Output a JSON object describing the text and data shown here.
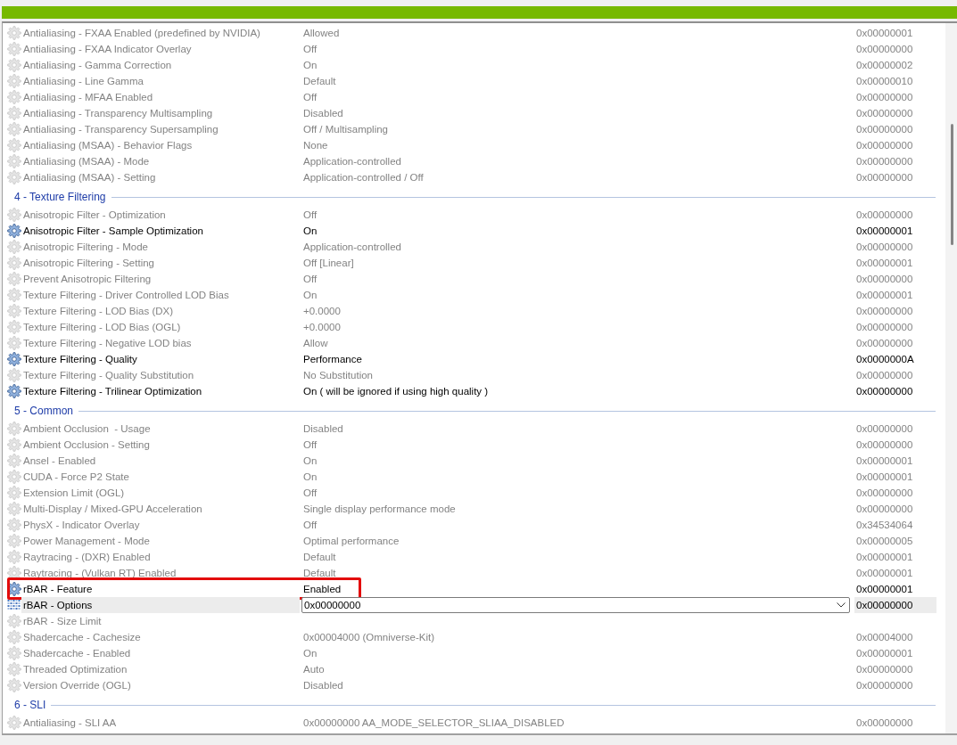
{
  "list": {
    "sections": [
      {
        "rows": [
          {
            "kind": "setting",
            "name": "Antialiasing - FXAA Enabled (predefined by NVIDIA)",
            "value": "Allowed",
            "hex": "0x00000001",
            "modified": false,
            "selected": false,
            "outlined": false
          },
          {
            "kind": "setting",
            "name": "Antialiasing - FXAA Indicator Overlay",
            "value": "Off",
            "hex": "0x00000000",
            "modified": false,
            "selected": false,
            "outlined": false
          },
          {
            "kind": "setting",
            "name": "Antialiasing - Gamma Correction",
            "value": "On",
            "hex": "0x00000002",
            "modified": false,
            "selected": false,
            "outlined": false
          },
          {
            "kind": "setting",
            "name": "Antialiasing - Line Gamma",
            "value": "Default",
            "hex": "0x00000010",
            "modified": false,
            "selected": false,
            "outlined": false
          },
          {
            "kind": "setting",
            "name": "Antialiasing - MFAA Enabled",
            "value": "Off",
            "hex": "0x00000000",
            "modified": false,
            "selected": false,
            "outlined": false
          },
          {
            "kind": "setting",
            "name": "Antialiasing - Transparency Multisampling",
            "value": "Disabled",
            "hex": "0x00000000",
            "modified": false,
            "selected": false,
            "outlined": false
          },
          {
            "kind": "setting",
            "name": "Antialiasing - Transparency Supersampling",
            "value": "Off / Multisampling",
            "hex": "0x00000000",
            "modified": false,
            "selected": false,
            "outlined": false
          },
          {
            "kind": "setting",
            "name": "Antialiasing (MSAA) - Behavior Flags",
            "value": "None",
            "hex": "0x00000000",
            "modified": false,
            "selected": false,
            "outlined": false
          },
          {
            "kind": "setting",
            "name": "Antialiasing (MSAA) - Mode",
            "value": "Application-controlled",
            "hex": "0x00000000",
            "modified": false,
            "selected": false,
            "outlined": false
          },
          {
            "kind": "setting",
            "name": "Antialiasing (MSAA) - Setting",
            "value": "Application-controlled / Off",
            "hex": "0x00000000",
            "modified": false,
            "selected": false,
            "outlined": false
          }
        ]
      },
      {
        "title": "4 - Texture Filtering",
        "rows": [
          {
            "kind": "setting",
            "name": "Anisotropic Filter - Optimization",
            "value": "Off",
            "hex": "0x00000000",
            "modified": false,
            "selected": false,
            "outlined": false
          },
          {
            "kind": "setting",
            "name": "Anisotropic Filter - Sample Optimization",
            "value": "On",
            "hex": "0x00000001",
            "modified": true,
            "selected": false,
            "outlined": false
          },
          {
            "kind": "setting",
            "name": "Anisotropic Filtering - Mode",
            "value": "Application-controlled",
            "hex": "0x00000000",
            "modified": false,
            "selected": false,
            "outlined": false
          },
          {
            "kind": "setting",
            "name": "Anisotropic Filtering - Setting",
            "value": "Off [Linear]",
            "hex": "0x00000001",
            "modified": false,
            "selected": false,
            "outlined": false
          },
          {
            "kind": "setting",
            "name": "Prevent Anisotropic Filtering",
            "value": "Off",
            "hex": "0x00000000",
            "modified": false,
            "selected": false,
            "outlined": false
          },
          {
            "kind": "setting",
            "name": "Texture Filtering - Driver Controlled LOD Bias",
            "value": "On",
            "hex": "0x00000001",
            "modified": false,
            "selected": false,
            "outlined": false
          },
          {
            "kind": "setting",
            "name": "Texture Filtering - LOD Bias (DX)",
            "value": "+0.0000",
            "hex": "0x00000000",
            "modified": false,
            "selected": false,
            "outlined": false
          },
          {
            "kind": "setting",
            "name": "Texture Filtering - LOD Bias (OGL)",
            "value": "+0.0000",
            "hex": "0x00000000",
            "modified": false,
            "selected": false,
            "outlined": false
          },
          {
            "kind": "setting",
            "name": "Texture Filtering - Negative LOD bias",
            "value": "Allow",
            "hex": "0x00000000",
            "modified": false,
            "selected": false,
            "outlined": false
          },
          {
            "kind": "setting",
            "name": "Texture Filtering - Quality",
            "value": "Performance",
            "hex": "0x0000000A",
            "modified": true,
            "selected": false,
            "outlined": false
          },
          {
            "kind": "setting",
            "name": "Texture Filtering - Quality Substitution",
            "value": "No Substitution",
            "hex": "0x00000000",
            "modified": false,
            "selected": false,
            "outlined": false
          },
          {
            "kind": "setting",
            "name": "Texture Filtering - Trilinear Optimization",
            "value": "On ( will be ignored if using high quality )",
            "hex": "0x00000000",
            "modified": true,
            "selected": false,
            "outlined": false
          }
        ]
      },
      {
        "title": "5 - Common",
        "rows": [
          {
            "kind": "setting",
            "name": "Ambient Occlusion  - Usage",
            "value": "Disabled",
            "hex": "0x00000000",
            "modified": false,
            "selected": false,
            "outlined": false
          },
          {
            "kind": "setting",
            "name": "Ambient Occlusion - Setting",
            "value": "Off",
            "hex": "0x00000000",
            "modified": false,
            "selected": false,
            "outlined": false
          },
          {
            "kind": "setting",
            "name": "Ansel - Enabled",
            "value": "On",
            "hex": "0x00000001",
            "modified": false,
            "selected": false,
            "outlined": false
          },
          {
            "kind": "setting",
            "name": "CUDA - Force P2 State",
            "value": "On",
            "hex": "0x00000001",
            "modified": false,
            "selected": false,
            "outlined": false
          },
          {
            "kind": "setting",
            "name": "Extension Limit (OGL)",
            "value": "Off",
            "hex": "0x00000000",
            "modified": false,
            "selected": false,
            "outlined": false
          },
          {
            "kind": "setting",
            "name": "Multi-Display / Mixed-GPU Acceleration",
            "value": "Single display performance mode",
            "hex": "0x00000000",
            "modified": false,
            "selected": false,
            "outlined": false
          },
          {
            "kind": "setting",
            "name": "PhysX - Indicator Overlay",
            "value": "Off",
            "hex": "0x34534064",
            "modified": false,
            "selected": false,
            "outlined": false
          },
          {
            "kind": "setting",
            "name": "Power Management - Mode",
            "value": "Optimal performance",
            "hex": "0x00000005",
            "modified": false,
            "selected": false,
            "outlined": false
          },
          {
            "kind": "setting",
            "name": "Raytracing - (DXR) Enabled",
            "value": "Default",
            "hex": "0x00000001",
            "modified": false,
            "selected": false,
            "outlined": false
          },
          {
            "kind": "setting",
            "name": "Raytracing - (Vulkan RT) Enabled",
            "value": "Default",
            "hex": "0x00000001",
            "modified": false,
            "selected": false,
            "outlined": false
          },
          {
            "kind": "setting",
            "name": "rBAR - Feature",
            "value": "Enabled",
            "hex": "0x00000001",
            "modified": true,
            "selected": false,
            "outlined": true
          },
          {
            "kind": "dropdown",
            "name": "rBAR - Options",
            "value": "0x00000000",
            "hex": "0x00000000",
            "modified": false,
            "selected": true,
            "outlined": false
          },
          {
            "kind": "setting",
            "name": "rBAR - Size Limit",
            "modified": false,
            "selected": false,
            "outlined": false
          },
          {
            "kind": "setting",
            "name": "Shadercache - Cachesize",
            "value": "0x00004000 (Omniverse-Kit)",
            "hex": "0x00004000",
            "modified": false,
            "selected": false,
            "outlined": false
          },
          {
            "kind": "setting",
            "name": "Shadercache - Enabled",
            "value": "On",
            "hex": "0x00000001",
            "modified": false,
            "selected": false,
            "outlined": false
          },
          {
            "kind": "setting",
            "name": "Threaded Optimization",
            "value": "Auto",
            "hex": "0x00000000",
            "modified": false,
            "selected": false,
            "outlined": false
          },
          {
            "kind": "setting",
            "name": "Version Override (OGL)",
            "value": "Disabled",
            "hex": "0x00000000",
            "modified": false,
            "selected": false,
            "outlined": false
          }
        ]
      },
      {
        "title": "6 - SLI",
        "rows": [
          {
            "kind": "setting",
            "name": "Antialiasing - SLI AA",
            "value": "0x00000000 AA_MODE_SELECTOR_SLIAA_DISABLED",
            "hex": "0x00000000",
            "modified": false,
            "selected": false,
            "outlined": false
          }
        ]
      }
    ]
  }
}
